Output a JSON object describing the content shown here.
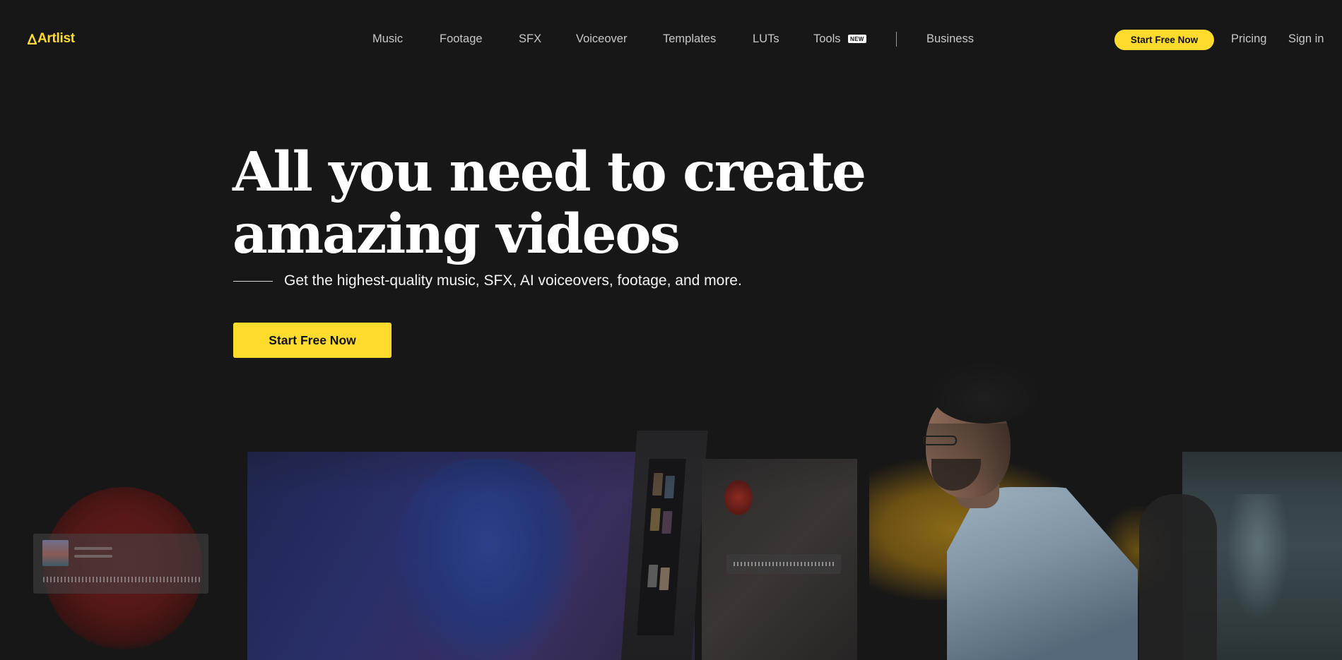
{
  "header": {
    "logo_text": "Artlist",
    "nav": [
      {
        "label": "Music"
      },
      {
        "label": "Footage"
      },
      {
        "label": "SFX"
      },
      {
        "label": "Voiceover"
      },
      {
        "label": "Templates"
      },
      {
        "label": "LUTs"
      },
      {
        "label": "Tools",
        "badge": "NEW"
      },
      {
        "label": "Business"
      }
    ],
    "cta_label": "Start Free Now",
    "pricing_label": "Pricing",
    "signin_label": "Sign in"
  },
  "hero": {
    "title_line1": "All you need to create",
    "title_line2": "amazing videos",
    "subtitle": "Get the highest-quality music, SFX, AI voiceovers, footage, and more.",
    "cta_label": "Start Free Now"
  },
  "colors": {
    "background": "#171717",
    "accent": "#ffdb2e",
    "nav_text": "#c8c8c8",
    "text": "#ffffff"
  },
  "icons": {
    "logo": "artlist-triangle-logo-icon"
  }
}
